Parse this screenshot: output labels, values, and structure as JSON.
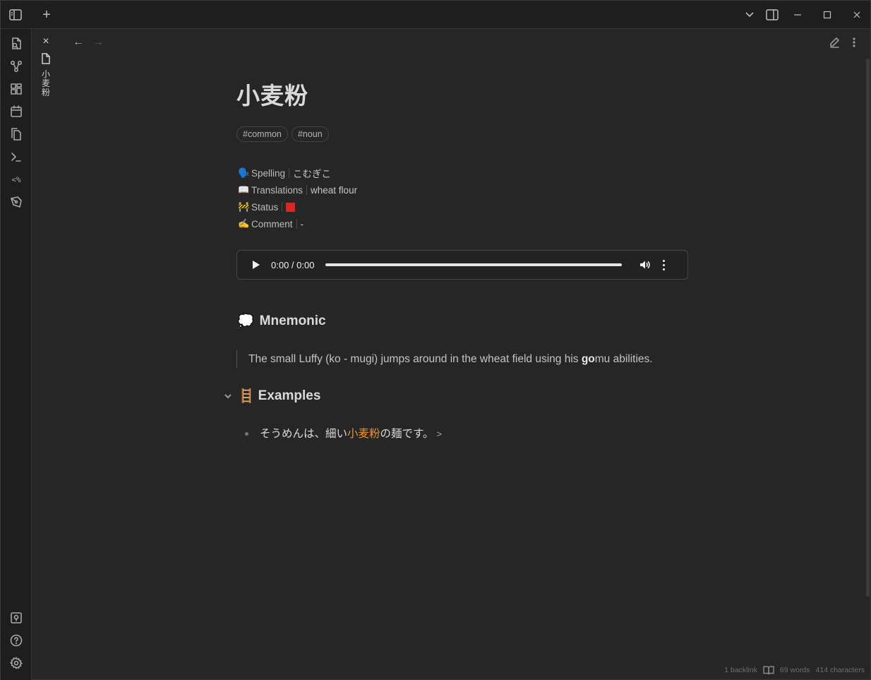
{
  "note": {
    "title": "小麦粉",
    "tags": [
      "#common",
      "#noun"
    ]
  },
  "properties": [
    {
      "emoji": "🗣️",
      "key": "Spelling",
      "value": "こむぎこ"
    },
    {
      "emoji": "📖",
      "key": "Translations",
      "value": "wheat flour"
    },
    {
      "emoji": "🚧",
      "key": "Status",
      "value": ""
    },
    {
      "emoji": "✍️",
      "key": "Comment",
      "value": "-"
    }
  ],
  "status_color": "#e02424",
  "audio": {
    "time": "0:00 / 0:00",
    "progress": 0
  },
  "mnemonic": {
    "emoji": "💭",
    "heading": "Mnemonic",
    "text_before": "The small Luffy (ko - mugi) jumps around in the wheat field using his ",
    "text_bold": "go",
    "text_after": "mu abilities."
  },
  "examples": {
    "emoji": "🪜",
    "heading": "Examples",
    "items": [
      {
        "before": "そうめんは、細い",
        "highlight": "小麦粉",
        "after": "の麺です。",
        "link": ">"
      }
    ]
  },
  "tab": {
    "title_chars": [
      "小",
      "麦",
      "粉"
    ]
  },
  "statusbar": {
    "backlinks": "1 backlink",
    "words": "69 words",
    "characters": "414 characters"
  },
  "accent_color": "#e8932c",
  "ribbon_icons": [
    "open-quick-switcher-icon",
    "graph-view-icon",
    "canvas-icon",
    "daily-note-icon",
    "templates-icon",
    "command-palette-icon",
    "templater-icon",
    "excalidraw-icon",
    "vault-switcher-icon",
    "help-icon",
    "settings-icon"
  ]
}
